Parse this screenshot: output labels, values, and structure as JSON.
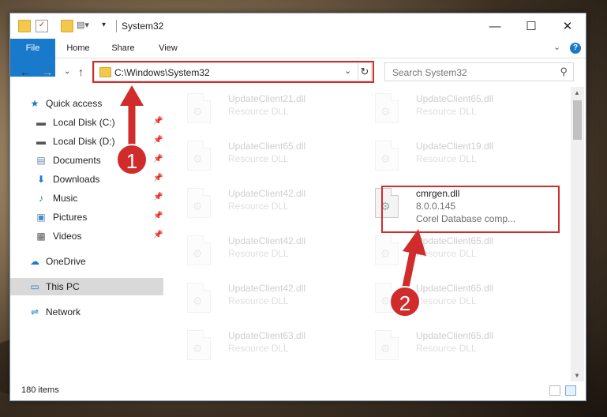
{
  "window": {
    "title": "System32",
    "buttons": {
      "minimize": "—",
      "maximize": "☐",
      "close": "✕"
    }
  },
  "ribbon": {
    "tabs": [
      "File",
      "Home",
      "Share",
      "View"
    ],
    "expand_icon": "chevron-down-icon",
    "help": "?"
  },
  "nav": {
    "address": "C:\\Windows\\System32",
    "search_placeholder": "Search System32"
  },
  "sidebar": {
    "items": [
      {
        "label": "Quick access",
        "icon": "star-icon"
      },
      {
        "label": "Local Disk (C:)",
        "icon": "drive-icon",
        "pinned": true
      },
      {
        "label": "Local Disk (D:)",
        "icon": "drive-icon",
        "pinned": true
      },
      {
        "label": "Documents",
        "icon": "documents-icon",
        "pinned": true
      },
      {
        "label": "Downloads",
        "icon": "download-icon",
        "pinned": true
      },
      {
        "label": "Music",
        "icon": "music-icon",
        "pinned": true
      },
      {
        "label": "Pictures",
        "icon": "pictures-icon",
        "pinned": true
      },
      {
        "label": "Videos",
        "icon": "videos-icon",
        "pinned": true
      },
      {
        "label": "OneDrive",
        "icon": "cloud-icon"
      },
      {
        "label": "This PC",
        "icon": "computer-icon",
        "selected": true
      },
      {
        "label": "Network",
        "icon": "network-icon"
      }
    ]
  },
  "files": {
    "left": [
      {
        "name": "UpdateClient21.dll",
        "type": "Resource DLL"
      },
      {
        "name": "UpdateClient65.dll",
        "type": "Resource DLL"
      },
      {
        "name": "UpdateClient42.dll",
        "type": "Resource DLL"
      },
      {
        "name": "UpdateClient42.dll",
        "type": "Resource DLL"
      },
      {
        "name": "UpdateClient42.dll",
        "type": "Resource DLL"
      },
      {
        "name": "UpdateClient63.dll",
        "type": "Resource DLL"
      }
    ],
    "right": [
      {
        "name": "UpdateClient65.dll",
        "type": "Resource DLL"
      },
      {
        "name": "UpdateClient19.dll",
        "type": "Resource DLL"
      },
      {
        "name": "cmrgen.dll",
        "version": "8.0.0.145",
        "description": "Corel Database comp...",
        "highlighted": true
      },
      {
        "name": "UpdateClient65.dll",
        "type": "Resource DLL"
      },
      {
        "name": "UpdateClient65.dll",
        "type": "Resource DLL"
      },
      {
        "name": "UpdateClient65.dll",
        "type": "Resource DLL"
      }
    ]
  },
  "status": {
    "item_count": "180 items"
  },
  "callouts": [
    "1",
    "2"
  ],
  "colors": {
    "accent": "#1979ca",
    "highlight": "#d12c2c"
  }
}
